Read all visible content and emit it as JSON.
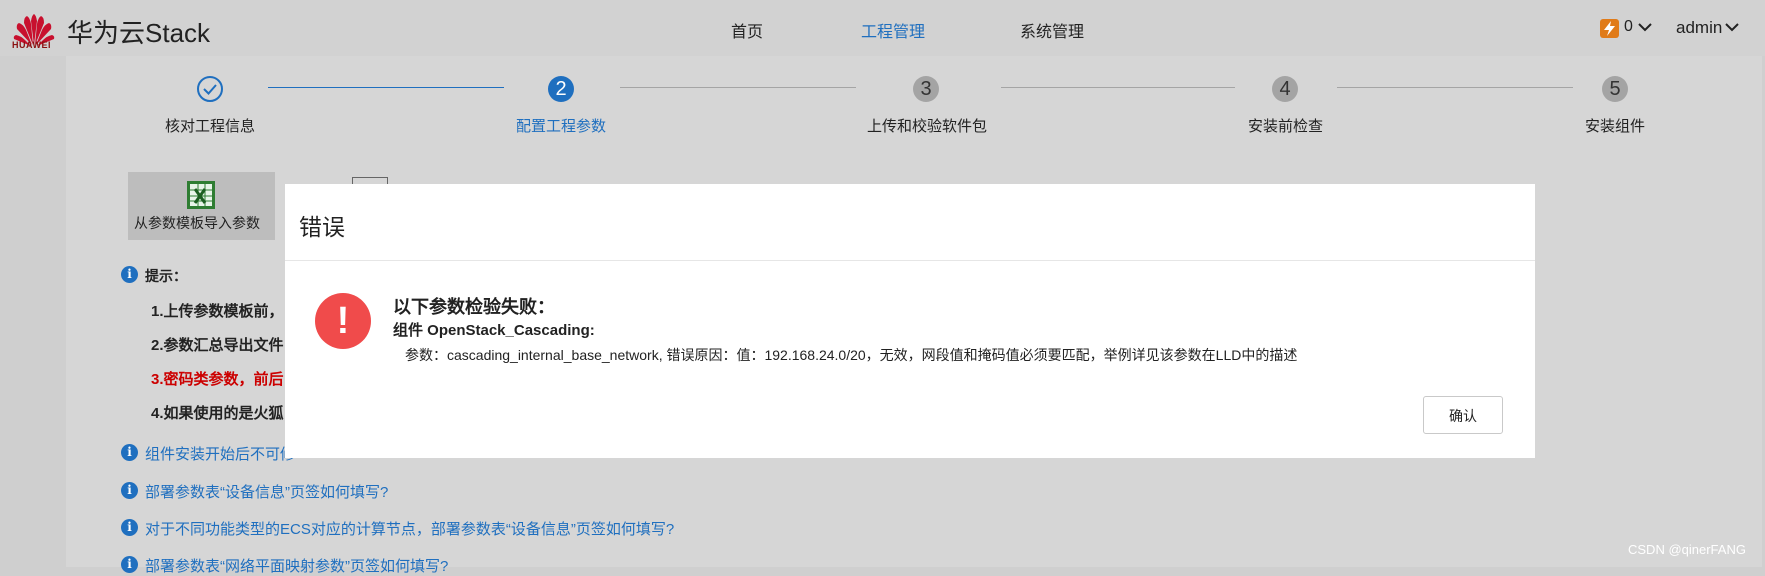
{
  "header": {
    "logo_text": "HUAWEI",
    "brand": "华为云Stack",
    "nav": [
      "首页",
      "工程管理",
      "系统管理"
    ],
    "notify_count": "0",
    "user": "admin"
  },
  "steps": [
    {
      "number": "",
      "label": "核对工程信息",
      "status": "done"
    },
    {
      "number": "2",
      "label": "配置工程参数",
      "status": "current"
    },
    {
      "number": "3",
      "label": "上传和校验软件包",
      "status": "pending"
    },
    {
      "number": "4",
      "label": "安装前检查",
      "status": "pending"
    },
    {
      "number": "5",
      "label": "安装组件",
      "status": "pending"
    }
  ],
  "toolbar": {
    "import_label": "从参数模板导入参数"
  },
  "tips": {
    "title": "提示：",
    "lines": [
      "1.上传参数模板前，",
      "2.参数汇总导出文件",
      "3.",
      "4.如果使用的是火狐"
    ],
    "line3_red": "密码类参数，前后"
  },
  "links": [
    "组件安装开始后不可修",
    "部署参数表“设备信息”页签如何填写?",
    "对于不同功能类型的ECS对应的计算节点，部署参数表“设备信息”页签如何填写?",
    "部署参数表“网络平面映射参数”页签如何填写?"
  ],
  "modal": {
    "title": "错误",
    "icon": "!",
    "heading": "以下参数检验失败：",
    "component": "组件 OpenStack_Cascading:",
    "detail": "参数：cascading_internal_base_network, 错误原因：值：192.168.24.0/20，无效，网段值和掩码值必须要匹配，举例详见该参数在LLD中的描述",
    "confirm": "确认"
  },
  "watermark": "CSDN @qinerFANG",
  "colors": {
    "accent": "#1f6fbf",
    "error": "#f04b4b",
    "notify": "#e07b19"
  }
}
